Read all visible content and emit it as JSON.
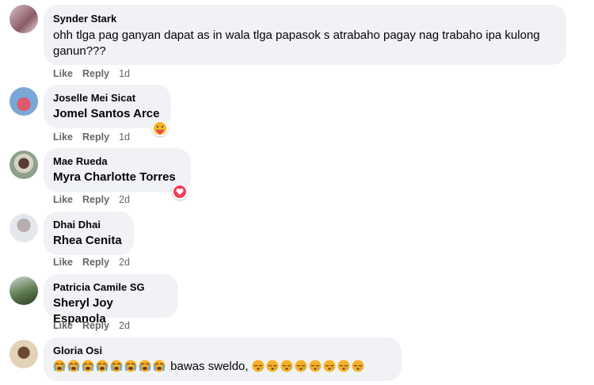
{
  "labels": {
    "like": "Like",
    "reply": "Reply"
  },
  "comments": [
    {
      "author": "Synder Stark",
      "text": "ohh tlga pag ganyan dapat as in wala tlga papasok s atrabaho pagay nag trabaho ipa kulong ganun???",
      "time": "1d"
    },
    {
      "author": "Joselle Mei Sicat",
      "text": "Jomel Santos Arce",
      "time": "1d",
      "reaction": "care-emoji"
    },
    {
      "author": "Mae Rueda",
      "text": "Myra Charlotte Torres",
      "time": "2d",
      "reaction": "love-heart"
    },
    {
      "author": "Dhai Dhai",
      "text": "Rhea Cenita",
      "time": "2d"
    },
    {
      "author": "Patricia Camile SG",
      "text": "Sheryl Joy Espanola",
      "time": "2d"
    },
    {
      "author": "Gloria Osi",
      "text": "bawas sweldo,",
      "emoji_before": "crying-face",
      "emoji_after": "sleepy-face"
    }
  ],
  "colors": {
    "bubble": "#f0f2f5",
    "meta": "#65676b",
    "love": "#f33e58",
    "emoji": "#f7b125"
  }
}
